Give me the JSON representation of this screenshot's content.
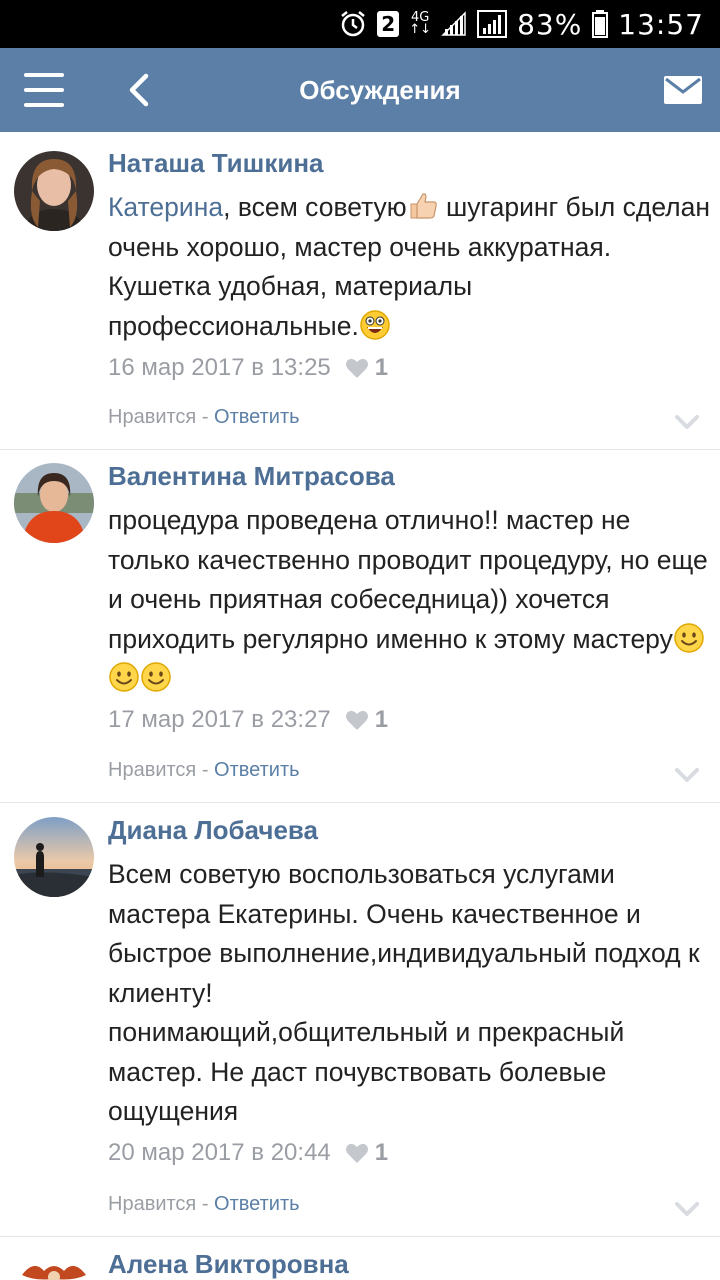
{
  "status_bar": {
    "sim_number": "2",
    "network": "4G",
    "battery": "83%",
    "time": "13:57"
  },
  "app_bar": {
    "title": "Обсуждения"
  },
  "comments": [
    {
      "author": "Наташа Тишкина",
      "mention": "Катерина",
      "text_1": ", всем советую",
      "emoji_1": "thumbs-up",
      "text_2": " шугаринг был сделан очень хорошо, мастер очень аккуратная. Кушетка удобная, материалы профессиональные.",
      "emoji_2": "grinning-face",
      "date": "16 мар 2017 в 13:25",
      "likes": "1",
      "like_label": "Нравится",
      "separator": " - ",
      "reply_label": "Ответить"
    },
    {
      "author": "Валентина Митрасова",
      "text_1": "процедура проведена отлично!! мастер не только качественно проводит процедуру, но еще и очень приятная собеседница)) хочется приходить регулярно именно к этому мастеру",
      "emoji_1": "smiling-face",
      "date": "17 мар 2017 в 23:27",
      "likes": "1",
      "like_label": "Нравится",
      "separator": " - ",
      "reply_label": "Ответить"
    },
    {
      "author": "Диана Лобачева",
      "text_1": "Всем советую воспользоваться услугами мастера Екатерины. Очень качественное и быстрое выполнение,индивидуальный подход к клиенту!",
      "text_2": "понимающий,общительный и прекрасный мастер. Не даст почувствовать болевые ощущения",
      "date": "20 мар 2017 в 20:44",
      "likes": "1",
      "like_label": "Нравится",
      "separator": " - ",
      "reply_label": "Ответить"
    },
    {
      "author": "Алена Викторовна"
    }
  ],
  "colors": {
    "app_bar": "#5b7fa6",
    "link": "#4e6f95",
    "muted": "#9a9ea4"
  }
}
